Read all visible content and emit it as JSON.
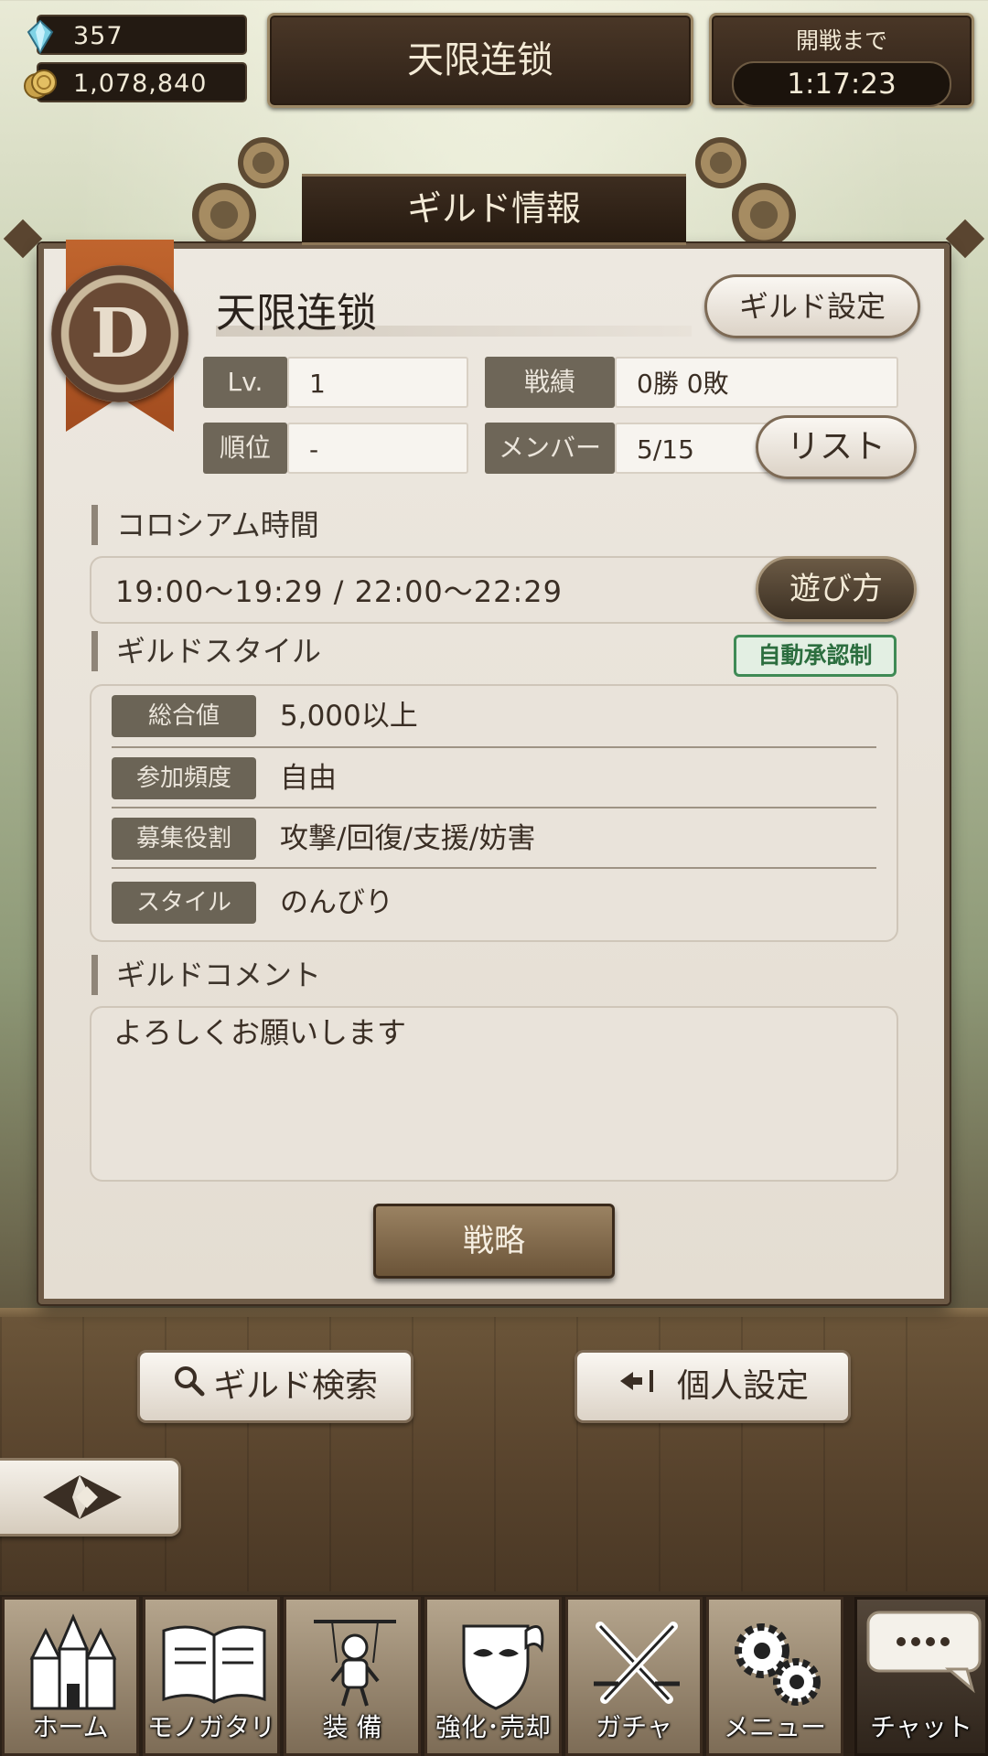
{
  "header": {
    "crystals": "357",
    "coins": "1,078,840",
    "guild_title": "天限连锁",
    "timer_label": "開戦まで",
    "timer_value": "1:17:23"
  },
  "panel": {
    "title": "ギルド情報",
    "emblem_letter": "D",
    "guild_name": "天限连锁",
    "settings_button": "ギルド設定",
    "stats": {
      "level_label": "Lv.",
      "level_value": "1",
      "record_label": "戦績",
      "record_value": "0勝 0敗",
      "rank_label": "順位",
      "rank_value": "-",
      "members_label": "メンバー",
      "members_value": "5/15",
      "list_button": "リスト"
    },
    "colosseum": {
      "title": "コロシアム時間",
      "times": "19:00～19:29  /  22:00～22:29",
      "howto_button": "遊び方"
    },
    "style": {
      "title": "ギルドスタイル",
      "badge": "自動承認制",
      "rows": [
        {
          "label": "総合値",
          "value": "5,000以上"
        },
        {
          "label": "参加頻度",
          "value": "自由"
        },
        {
          "label": "募集役割",
          "value": "攻撃/回復/支援/妨害"
        },
        {
          "label": "スタイル",
          "value": "のんびり"
        }
      ]
    },
    "comment": {
      "title": "ギルドコメント",
      "text": "よろしくお願いします"
    },
    "strategy_button": "戦略"
  },
  "actions": {
    "search_button": "ギルド検索",
    "personal_button": "個人設定"
  },
  "nav": {
    "items": [
      {
        "label": "ホーム",
        "icon": "castle-icon"
      },
      {
        "label": "モノガタリ",
        "icon": "book-icon"
      },
      {
        "label": "装 備",
        "icon": "puppet-icon"
      },
      {
        "label": "強化･売却",
        "icon": "mask-shield-icon"
      },
      {
        "label": "ガチャ",
        "icon": "crossed-swords-icon"
      },
      {
        "label": "メニュー",
        "icon": "gears-icon"
      },
      {
        "label": "チャット",
        "icon": "chat-bubble-icon"
      }
    ]
  },
  "colors": {
    "panel_bg": "#e9e3da",
    "accent_brown": "#6b5438",
    "badge_green": "#3f8a55",
    "ribbon_orange": "#c0652e"
  }
}
